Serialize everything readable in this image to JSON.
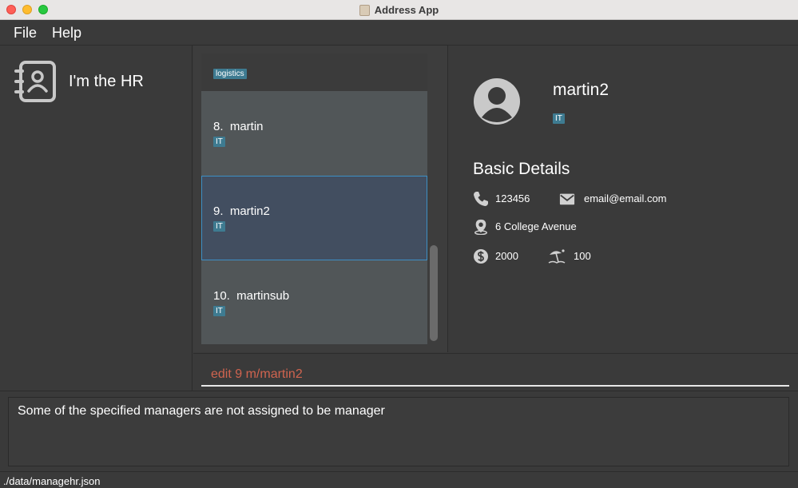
{
  "window": {
    "title": "Address App"
  },
  "menu": {
    "file_label": "File",
    "help_label": "Help"
  },
  "sidebar": {
    "app_name": "I'm the HR",
    "icon": "address-book-icon"
  },
  "person_list": {
    "items": [
      {
        "title": "",
        "tag": "logistics"
      },
      {
        "title": "8.  martin",
        "tag": "IT"
      },
      {
        "title": "9.  martin2",
        "tag": "IT",
        "selected": true
      },
      {
        "title": "10.  martinsub",
        "tag": "IT"
      }
    ]
  },
  "details": {
    "name": "martin2",
    "tag": "IT",
    "section_title": "Basic Details",
    "phone": "123456",
    "email": "email@email.com",
    "address": "6 College Avenue",
    "salary": "2000",
    "leave": "100"
  },
  "command": {
    "value": "edit 9 m/martin2"
  },
  "result": {
    "message": "Some of the specified managers are not assigned to be manager"
  },
  "status": {
    "file_path": "./data/managehr.json"
  },
  "colors": {
    "background": "#3a3a3a",
    "card": "#515658",
    "selected_card": "#424e60",
    "selected_border": "#3d8fc4",
    "tag": "#3e7b91",
    "command_text": "#d0644f"
  }
}
